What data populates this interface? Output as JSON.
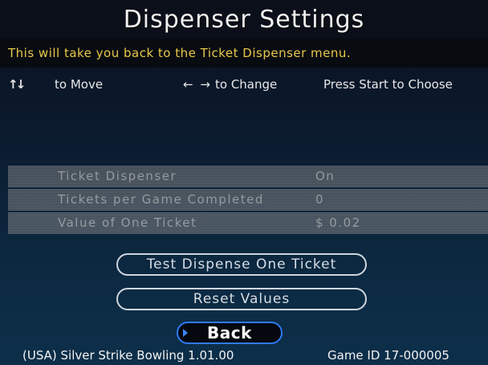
{
  "header": {
    "title": "Dispenser Settings",
    "subtitle": "This will take you back to the Ticket Dispenser menu."
  },
  "help": {
    "move_arrows": "↑↓",
    "move_label": "to Move",
    "change_arrows": "← →",
    "change_label": "to Change",
    "choose_label": "Press Start to Choose"
  },
  "settings": [
    {
      "label": "Ticket Dispenser",
      "value": "On"
    },
    {
      "label": "Tickets per Game Completed",
      "value": "0"
    },
    {
      "label": "Value of One Ticket",
      "value": "$ 0.02"
    }
  ],
  "actions": {
    "test_dispense_label": "Test Dispense One Ticket",
    "reset_label": "Reset Values",
    "back_label": "Back"
  },
  "footer": {
    "game_version": "(USA) Silver Strike Bowling 1.01.00",
    "game_id": "Game ID 17-000005"
  },
  "colors": {
    "subtitle": "#e8c84a",
    "back_border": "#2f7af5"
  }
}
